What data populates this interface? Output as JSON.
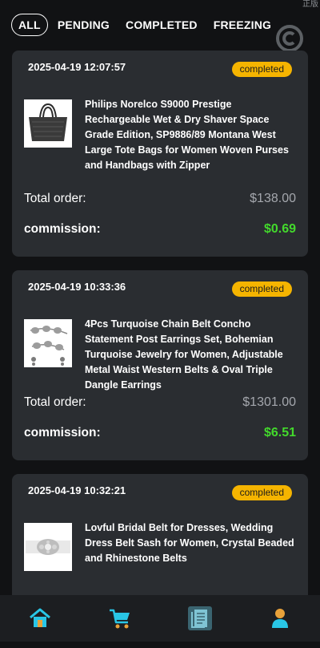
{
  "corner_text": "正版",
  "tabs": [
    {
      "label": "ALL",
      "active": true
    },
    {
      "label": "PENDING",
      "active": false
    },
    {
      "label": "COMPLETED",
      "active": false
    },
    {
      "label": "FREEZING",
      "active": false
    }
  ],
  "orders": [
    {
      "date": "2025-04-19 12:07:57",
      "status": "completed",
      "product": "Philips Norelco S9000 Prestige Rechargeable Wet & Dry Shaver Space Grade Edition, SP9886/89 Montana West Large Tote Bags for Women Woven Purses and Handbags with Zipper",
      "total_label": "Total order:",
      "total_value": "$138.00",
      "commission_label": "commission:",
      "commission_value": "$0.69"
    },
    {
      "date": "2025-04-19 10:33:36",
      "status": "completed",
      "product": "4Pcs Turquoise Chain Belt Concho Statement Post Earrings Set, Bohemian Turquoise Jewelry for Women, Adjustable Metal Waist Western Belts & Oval Triple Dangle Earrings",
      "total_label": "Total order:",
      "total_value": "$1301.00",
      "commission_label": "commission:",
      "commission_value": "$6.51"
    },
    {
      "date": "2025-04-19 10:32:21",
      "status": "completed",
      "product": "Lovful Bridal Belt for Dresses, Wedding Dress Belt Sash for Women, Crystal Beaded and Rhinestone Belts"
    }
  ],
  "nav": [
    {
      "icon": "home-icon"
    },
    {
      "icon": "cart-icon"
    },
    {
      "icon": "orders-icon"
    },
    {
      "icon": "profile-icon"
    }
  ],
  "colors": {
    "badge": "#f5b400",
    "commission": "#43d92c",
    "card": "#2a2d31",
    "nav_icon": "#29c6e6"
  }
}
